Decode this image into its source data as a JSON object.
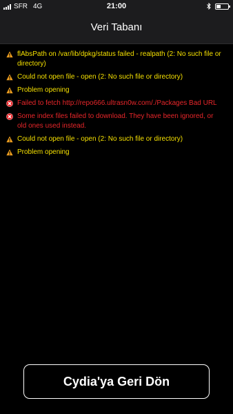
{
  "status_bar": {
    "carrier": "SFR",
    "network": "4G",
    "time": "21:00",
    "battery_level": 0.4
  },
  "nav": {
    "title": "Veri Tabanı"
  },
  "colors": {
    "warning": "#f5e000",
    "error": "#e8262a",
    "background": "#000000"
  },
  "messages": [
    {
      "type": "warning",
      "icon": "warning-icon",
      "text": "flAbsPath on /var/lib/dpkg/status failed - realpath (2: No such file or directory)"
    },
    {
      "type": "warning",
      "icon": "warning-icon",
      "text": "Could not open file - open (2: No such file or directory)"
    },
    {
      "type": "warning",
      "icon": "warning-icon",
      "text": "Problem opening"
    },
    {
      "type": "error",
      "icon": "error-icon",
      "text": "Failed to fetch http://repo666.ultrasn0w.com/./Packages Bad URL"
    },
    {
      "type": "error",
      "icon": "error-icon",
      "text": "Some index files failed to download. They have been ignored, or old ones used instead."
    },
    {
      "type": "warning",
      "icon": "warning-icon",
      "text": "Could not open file - open (2: No such file or directory)"
    },
    {
      "type": "warning",
      "icon": "warning-icon",
      "text": "Problem opening"
    }
  ],
  "button": {
    "label": "Cydia'ya Geri Dön"
  }
}
